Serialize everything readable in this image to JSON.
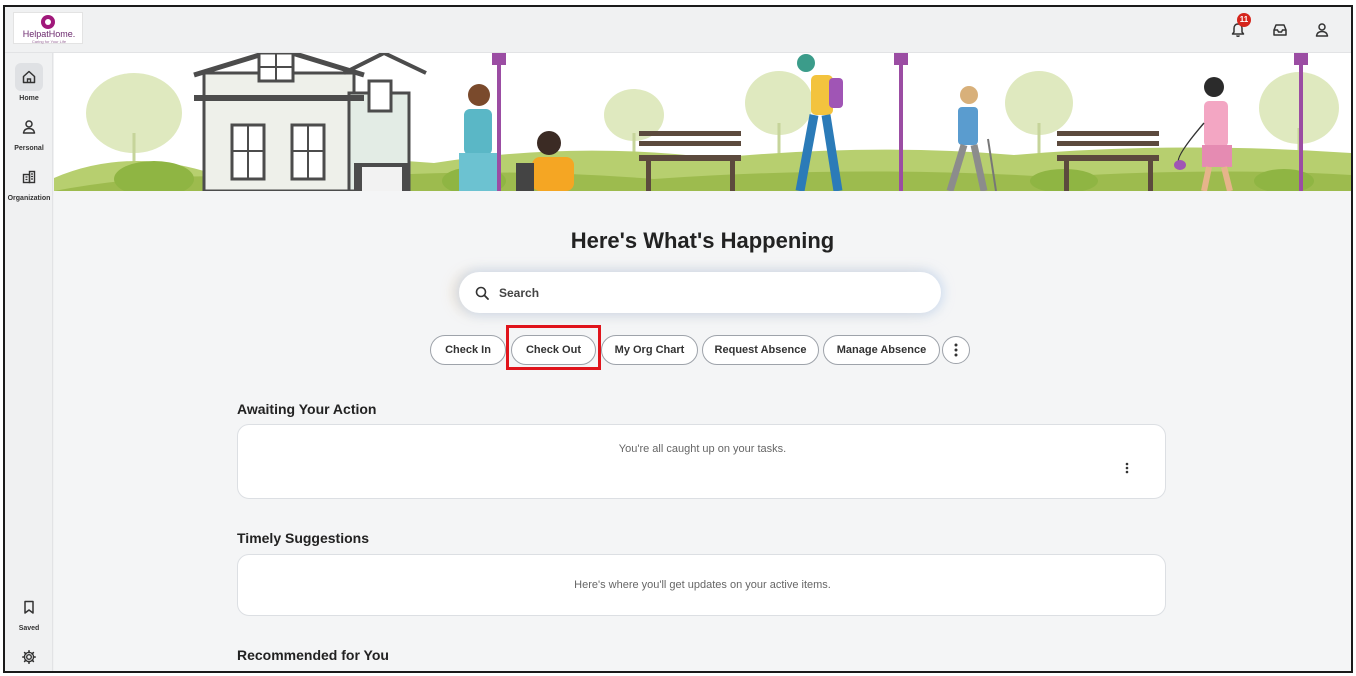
{
  "brand": {
    "logo_text": "HelpatHome.",
    "logo_tagline": "Caring for Your Life"
  },
  "topbar": {
    "notification_count": "11"
  },
  "rail": {
    "items": [
      {
        "label": "Home"
      },
      {
        "label": "Personal"
      },
      {
        "label": "Organization"
      }
    ],
    "saved_label": "Saved"
  },
  "main": {
    "heading": "Here's What's Happening",
    "search": {
      "placeholder": "Search"
    },
    "quick_actions": [
      {
        "label": "Check In"
      },
      {
        "label": "Check Out"
      },
      {
        "label": "My Org Chart"
      },
      {
        "label": "Request Absence"
      },
      {
        "label": "Manage Absence"
      }
    ],
    "sections": [
      {
        "title": "Awaiting Your Action",
        "message": "You're all caught up on your tasks."
      },
      {
        "title": "Timely Suggestions",
        "message": "Here's where you'll get updates on your active items."
      },
      {
        "title": "Recommended for You"
      }
    ]
  },
  "colors": {
    "highlight": "#e0141b",
    "badge": "#d5251c",
    "brand": "#a0187a"
  }
}
